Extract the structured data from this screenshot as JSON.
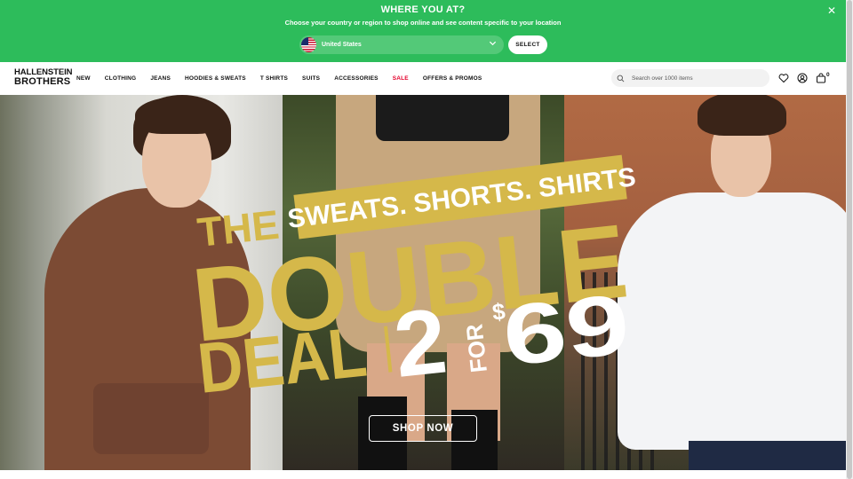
{
  "banner": {
    "title": "WHERE YOU AT?",
    "subtitle": "Choose your country or region to shop online and see content specific to your location",
    "country": "United States",
    "select_label": "SELECT",
    "close_icon": "close-icon"
  },
  "header": {
    "logo_line1": "HALLENSTEIN",
    "logo_line2": "BROTHERS",
    "nav": [
      "NEW",
      "CLOTHING",
      "JEANS",
      "HOODIES & SWEATS",
      "T SHIRTS",
      "SUITS",
      "ACCESSORIES",
      "SALE",
      "OFFERS & PROMOS"
    ],
    "sale_color": "#e4002b",
    "search_placeholder": "Search over 1000 items",
    "cart_count": "0",
    "icons": [
      "search-icon",
      "heart-icon",
      "account-icon",
      "bag-icon"
    ]
  },
  "hero": {
    "headline_the": "THE",
    "headline_double": "DOUBLE",
    "headline_deal": "DEAL",
    "banner_strip": "SWEATS. SHORTS. SHIRTS",
    "price_two": "2",
    "price_for": "FOR",
    "price_currency": "$",
    "price_amount": "69",
    "cta": "SHOP NOW",
    "accent_color": "#d5b84a"
  },
  "colors": {
    "banner_bg": "#2dbc5b",
    "header_bg": "#ffffff",
    "text": "#111111"
  }
}
